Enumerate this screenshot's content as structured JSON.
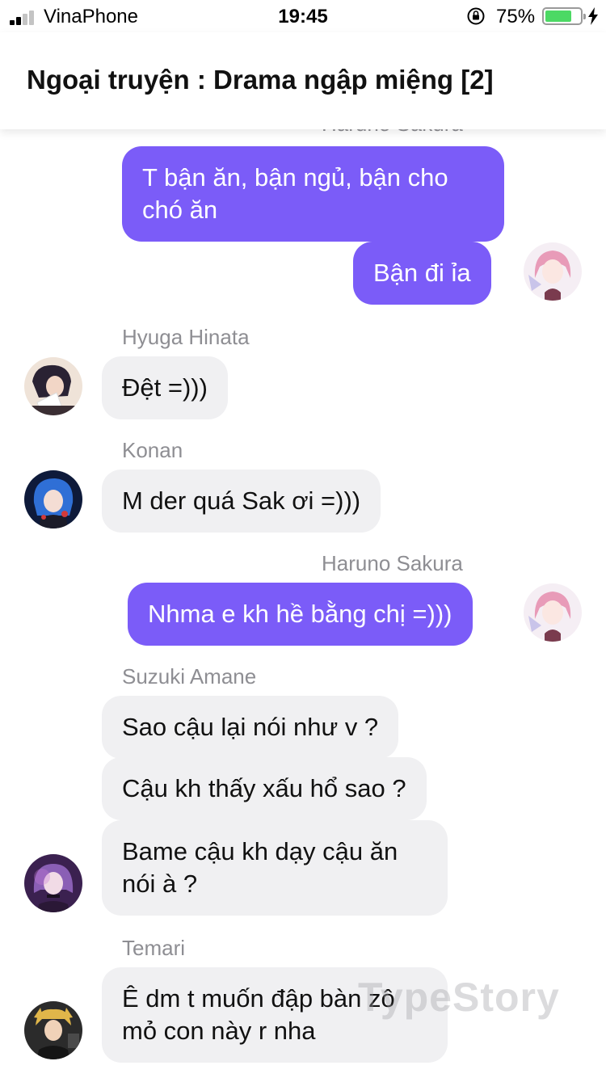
{
  "status_bar": {
    "carrier": "VinaPhone",
    "time": "19:45",
    "battery_percent": "75%",
    "battery_level": 0.75,
    "signal_bars": 2,
    "icons": [
      "signal-icon",
      "orientation-lock-icon",
      "battery-icon",
      "charging-bolt-icon"
    ]
  },
  "header": {
    "title": "Ngoại truyện : Drama ngập miệng [2]"
  },
  "colors": {
    "outgoing_bubble": "#7b5cf8",
    "incoming_bubble": "#f0f0f2",
    "sender_name": "#8e8e93"
  },
  "chat": {
    "messages": [
      {
        "sender": "Haruno Sakura",
        "outgoing": true,
        "texts": [
          "T bận ăn, bận ngủ, bận cho chó ăn",
          "Bận đi ỉa"
        ],
        "avatar": "sakura-avatar"
      },
      {
        "sender": "Hyuga Hinata",
        "outgoing": false,
        "texts": [
          "Đệt =)))"
        ],
        "avatar": "hinata-avatar"
      },
      {
        "sender": "Konan",
        "outgoing": false,
        "texts": [
          "M der quá Sak ơi =)))"
        ],
        "avatar": "konan-avatar"
      },
      {
        "sender": "Haruno Sakura",
        "outgoing": true,
        "texts": [
          "Nhma e kh hề bằng chị =)))"
        ],
        "avatar": "sakura-avatar"
      },
      {
        "sender": "Suzuki Amane",
        "outgoing": false,
        "texts": [
          "Sao cậu lại nói như v ?",
          "Cậu kh thấy xấu hổ sao ?",
          "Bame cậu kh dạy cậu ăn nói à ?"
        ],
        "avatar": "amane-avatar"
      },
      {
        "sender": "Temari",
        "outgoing": false,
        "texts": [
          "Ê dm t muốn đập bàn zô mỏ con này r nha"
        ],
        "avatar": "temari-avatar"
      }
    ]
  },
  "watermark": "TypeStory"
}
